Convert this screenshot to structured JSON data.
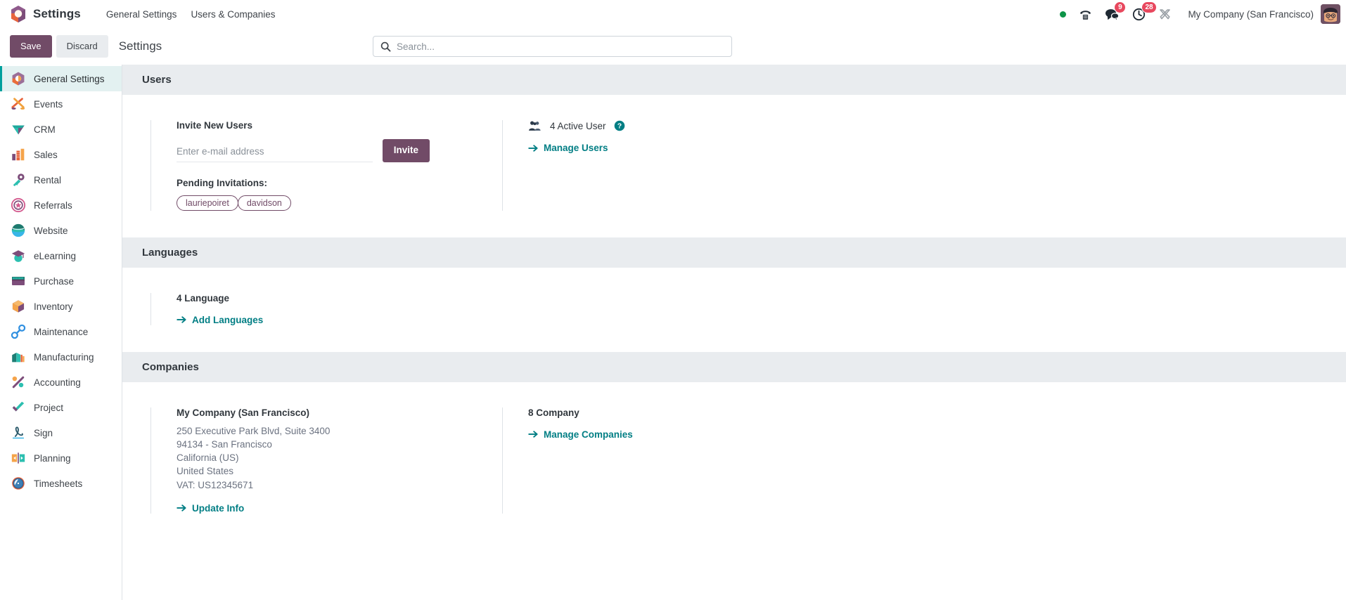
{
  "topbar": {
    "brand": "Settings",
    "menus": [
      "General Settings",
      "Users & Companies"
    ],
    "systray": [
      {
        "name": "presence-dot",
        "label": "",
        "badge": ""
      },
      {
        "name": "phone-icon",
        "label": "",
        "badge": ""
      },
      {
        "name": "messages-icon",
        "label": "",
        "badge": "9"
      },
      {
        "name": "activities-icon",
        "label": "",
        "badge": "28"
      },
      {
        "name": "debug-tools-icon",
        "label": "",
        "badge": ""
      }
    ],
    "company": "My Company (San Francisco)"
  },
  "control_panel": {
    "save_label": "Save",
    "discard_label": "Discard",
    "title": "Settings"
  },
  "search": {
    "placeholder": "Search...",
    "value": ""
  },
  "sidebar": {
    "items": [
      {
        "label": "General Settings",
        "icon": "settings-icon",
        "active": true
      },
      {
        "label": "Events",
        "icon": "events-icon",
        "active": false
      },
      {
        "label": "CRM",
        "icon": "crm-icon",
        "active": false
      },
      {
        "label": "Sales",
        "icon": "sales-icon",
        "active": false
      },
      {
        "label": "Rental",
        "icon": "rental-icon",
        "active": false
      },
      {
        "label": "Referrals",
        "icon": "referrals-icon",
        "active": false
      },
      {
        "label": "Website",
        "icon": "website-icon",
        "active": false
      },
      {
        "label": "eLearning",
        "icon": "elearning-icon",
        "active": false
      },
      {
        "label": "Purchase",
        "icon": "purchase-icon",
        "active": false
      },
      {
        "label": "Inventory",
        "icon": "inventory-icon",
        "active": false
      },
      {
        "label": "Maintenance",
        "icon": "maintenance-icon",
        "active": false
      },
      {
        "label": "Manufacturing",
        "icon": "manufacturing-icon",
        "active": false
      },
      {
        "label": "Accounting",
        "icon": "accounting-icon",
        "active": false
      },
      {
        "label": "Project",
        "icon": "project-icon",
        "active": false
      },
      {
        "label": "Sign",
        "icon": "sign-icon",
        "active": false
      },
      {
        "label": "Planning",
        "icon": "planning-icon",
        "active": false
      },
      {
        "label": "Timesheets",
        "icon": "timesheets-icon",
        "active": false
      }
    ]
  },
  "sections": {
    "users": {
      "heading": "Users",
      "invite_title": "Invite New Users",
      "invite_placeholder": "Enter e-mail address",
      "invite_value": "",
      "invite_button": "Invite",
      "pending_label": "Pending Invitations:",
      "pending_tags": [
        "lauriepoiret",
        "davidson"
      ],
      "active_users_count": "4 Active User",
      "manage_users_link": "Manage Users"
    },
    "languages": {
      "heading": "Languages",
      "count": "4 Language",
      "add_link": "Add Languages"
    },
    "companies": {
      "heading": "Companies",
      "company_name": "My Company (San Francisco)",
      "address": [
        "250 Executive Park Blvd, Suite 3400",
        "94134 - San Francisco",
        "California (US)",
        "United States",
        "VAT:  US12345671"
      ],
      "update_link": "Update Info",
      "count": "8 Company",
      "manage_link": "Manage Companies"
    }
  },
  "colors": {
    "primary": "#714B67",
    "accent_teal": "#017E84",
    "active_bg": "#E3F1F1",
    "section_band": "#E9ECEF",
    "badge_red": "#E8485E",
    "presence_green": "#0D9448"
  }
}
